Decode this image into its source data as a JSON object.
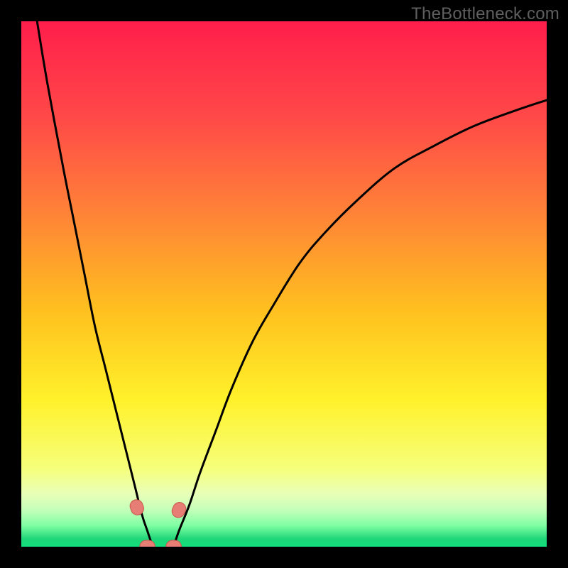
{
  "watermark": "TheBottleneck.com",
  "chart_data": {
    "type": "line",
    "title": "",
    "xlabel": "",
    "ylabel": "",
    "xlim": [
      0,
      100
    ],
    "ylim": [
      0,
      100
    ],
    "grid": false,
    "legend": false,
    "series": [
      {
        "name": "curve-left",
        "x": [
          3,
          5,
          8,
          10,
          12,
          14,
          16,
          18,
          20,
          21.5,
          23,
          24,
          25
        ],
        "values": [
          100,
          88,
          72,
          62,
          52,
          42,
          34,
          26,
          18,
          12,
          6,
          3,
          0
        ]
      },
      {
        "name": "curve-right",
        "x": [
          29,
          30,
          32,
          34,
          37,
          40,
          44,
          48,
          53,
          58,
          64,
          71,
          78,
          86,
          94,
          100
        ],
        "values": [
          0,
          3,
          8,
          14,
          22,
          30,
          39,
          46,
          54,
          60,
          66,
          72,
          76,
          80,
          83,
          85
        ]
      }
    ],
    "markers": [
      {
        "name": "marker-left-branch",
        "x": 22.0,
        "y": 7.5
      },
      {
        "name": "marker-right-branch",
        "x": 30.0,
        "y": 7.0
      },
      {
        "name": "marker-bottom-left",
        "x": 24.0,
        "y": 0.0
      },
      {
        "name": "marker-bottom-right",
        "x": 29.0,
        "y": 0.0
      }
    ],
    "gradient_stops": [
      {
        "offset": 0.0,
        "color": "#ff1e4b"
      },
      {
        "offset": 0.18,
        "color": "#ff4848"
      },
      {
        "offset": 0.36,
        "color": "#ff8138"
      },
      {
        "offset": 0.55,
        "color": "#ffc01f"
      },
      {
        "offset": 0.72,
        "color": "#fff12a"
      },
      {
        "offset": 0.85,
        "color": "#f6ff7a"
      },
      {
        "offset": 0.9,
        "color": "#e8ffb8"
      },
      {
        "offset": 0.93,
        "color": "#c4ffb9"
      },
      {
        "offset": 0.96,
        "color": "#7effa3"
      },
      {
        "offset": 0.985,
        "color": "#1fd678"
      },
      {
        "offset": 1.0,
        "color": "#12e07d"
      }
    ],
    "marker_style": {
      "fill": "#e77e75",
      "stroke": "#c9574c",
      "radius": 9
    },
    "curve_style": {
      "stroke": "#000000",
      "width": 3
    }
  }
}
